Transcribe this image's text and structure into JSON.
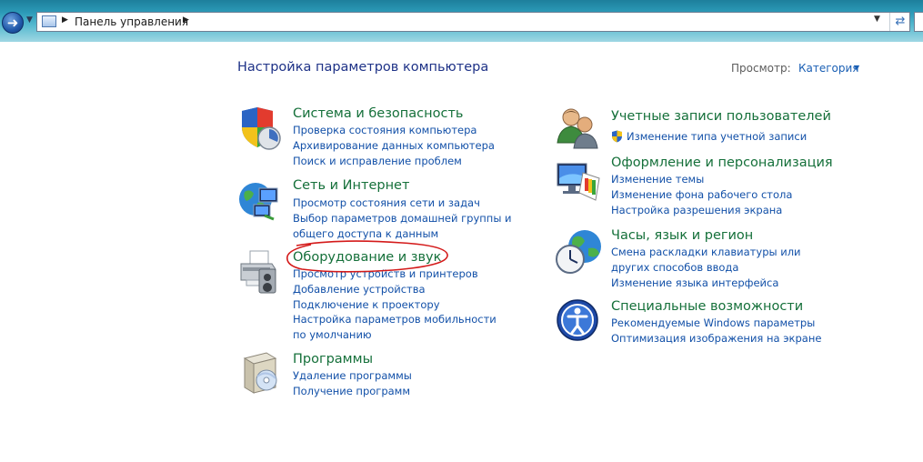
{
  "address_bar": {
    "path": "Панель управления"
  },
  "header": {
    "title": "Настройка параметров компьютера",
    "view_by_label": "Просмотр:",
    "view_by_value": "Категория"
  },
  "categories": [
    {
      "title": "Система и безопасность",
      "icon": "shield-icon",
      "links": [
        "Проверка состояния компьютера",
        "Архивирование данных компьютера",
        "Поиск и исправление проблем"
      ]
    },
    {
      "title": "Сеть и Интернет",
      "icon": "network-globe-icon",
      "links": [
        "Просмотр состояния сети и задач",
        "Выбор параметров домашней группы и общего доступа к данным"
      ]
    },
    {
      "title": "Оборудование и звук",
      "icon": "printer-icon",
      "links": [
        "Просмотр устройств и принтеров",
        "Добавление устройства",
        "Подключение к проектору",
        "Настройка параметров мобильности по умолчанию"
      ]
    },
    {
      "title": "Программы",
      "icon": "programs-box-icon",
      "links": [
        "Удаление программы",
        "Получение программ"
      ]
    },
    {
      "title": "Учетные записи пользователей",
      "icon": "users-icon",
      "links": [
        "Изменение типа учетной записи"
      ]
    },
    {
      "title": "Оформление и персонализация",
      "icon": "monitor-palette-icon",
      "links": [
        "Изменение темы",
        "Изменение фона рабочего стола",
        "Настройка разрешения экрана"
      ]
    },
    {
      "title": "Часы, язык и регион",
      "icon": "clock-globe-icon",
      "links": [
        "Смена раскладки клавиатуры или других способов ввода",
        "Изменение языка интерфейса"
      ]
    },
    {
      "title": "Специальные возможности",
      "icon": "accessibility-icon",
      "links": [
        "Рекомендуемые Windows параметры",
        "Оптимизация изображения на экране"
      ]
    }
  ],
  "colors": {
    "title_green": "#15703a",
    "link_blue": "#1250a8",
    "heading_blue": "#1e3287",
    "annotation_red": "#d41a1a"
  }
}
